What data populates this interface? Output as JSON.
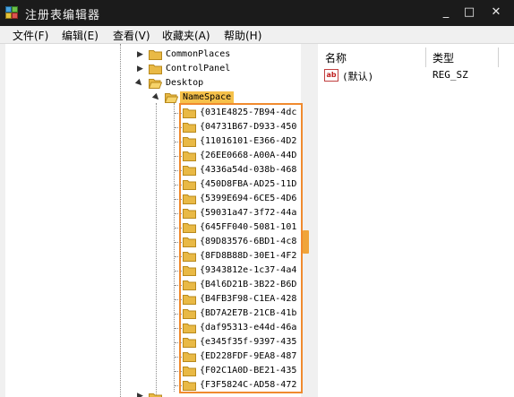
{
  "window": {
    "title": "注册表编辑器",
    "controls": {
      "minimize": "_",
      "maximize": "□",
      "close": "✕"
    }
  },
  "menu": [
    "文件(F)",
    "编辑(E)",
    "查看(V)",
    "收藏夹(A)",
    "帮助(H)"
  ],
  "tree": {
    "parents": [
      {
        "label": "CommonPlaces",
        "expanded": false
      },
      {
        "label": "ControlPanel",
        "expanded": false
      },
      {
        "label": "Desktop",
        "expanded": true
      }
    ],
    "selected": {
      "label": "NameSpace",
      "expanded": true
    },
    "children": [
      "{031E4825-7B94-4dc",
      "{04731B67-D933-450",
      "{11016101-E366-4D2",
      "{26EE0668-A00A-44D",
      "{4336a54d-038b-468",
      "{450D8FBA-AD25-11D",
      "{5399E694-6CE5-4D6",
      "{59031a47-3f72-44a",
      "{645FF040-5081-101",
      "{89D83576-6BD1-4c8",
      "{8FD8B88D-30E1-4F2",
      "{9343812e-1c37-4a4",
      "{B4l6D21B-3B22-B6D",
      "{B4FB3F98-C1EA-428",
      "{BD7A2E7B-21CB-41b",
      "{daf95313-e44d-46a",
      "{e345f35f-9397-435",
      "{ED228FDF-9EA8-487",
      "{F02C1A0D-BE21-435",
      "{F3F5824C-AD58-472"
    ]
  },
  "values": {
    "columns": {
      "name": "名称",
      "type": "类型"
    },
    "rows": [
      {
        "icon": "ab",
        "name": "(默认)",
        "type": "REG_SZ"
      }
    ]
  },
  "colors": {
    "highlight_border": "#f08a2e",
    "selection": "#f6c14a",
    "folder": "#e9b945"
  }
}
